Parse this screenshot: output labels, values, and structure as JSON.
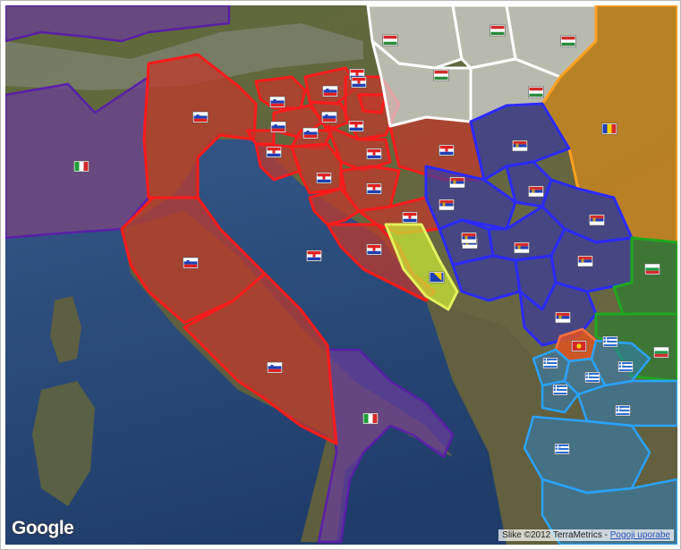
{
  "map": {
    "logo_text": "Google",
    "attribution_text": "Slike ©2012 TerraMetrics",
    "separator": " - ",
    "terms_link_text": "Pogoji uporabe"
  },
  "colors": {
    "sea": "#2b4d7c",
    "slovenia_region": "#c0392b",
    "slovenia_border": "#ff1a1a",
    "italy_region": "#6a3d9a",
    "hungary_region": "#d9d9d9",
    "romania_region": "#d4891c",
    "serbia_region": "#3a3a9c",
    "bulgaria_region": "#2e7d32",
    "greece_region": "#2d7fbd",
    "bosnia_region": "#c8e636",
    "macedonia_region": "#e0531f"
  },
  "region_flags": [
    {
      "region": "north-italy",
      "country": "italy"
    },
    {
      "region": "veneto",
      "country": "slovenia"
    },
    {
      "region": "tuscany",
      "country": "slovenia"
    },
    {
      "region": "lazio",
      "country": "slovenia"
    },
    {
      "region": "south-italy",
      "country": "italy"
    },
    {
      "region": "slovenia-1",
      "country": "slovenia"
    },
    {
      "region": "slovenia-2",
      "country": "slovenia"
    },
    {
      "region": "slovenia-3",
      "country": "slovenia"
    },
    {
      "region": "slovenia-4",
      "country": "slovenia"
    },
    {
      "region": "slovenia-5",
      "country": "slovenia"
    },
    {
      "region": "croatia-1",
      "country": "croatia"
    },
    {
      "region": "croatia-2",
      "country": "croatia"
    },
    {
      "region": "croatia-3",
      "country": "croatia"
    },
    {
      "region": "croatia-4",
      "country": "croatia"
    },
    {
      "region": "croatia-5",
      "country": "croatia"
    },
    {
      "region": "croatia-6",
      "country": "croatia"
    },
    {
      "region": "croatia-7",
      "country": "croatia"
    },
    {
      "region": "croatia-8",
      "country": "croatia"
    },
    {
      "region": "croatia-9",
      "country": "croatia"
    },
    {
      "region": "croatia-10",
      "country": "croatia"
    },
    {
      "region": "croatia-11",
      "country": "croatia"
    },
    {
      "region": "bosnia",
      "country": "bosnia"
    },
    {
      "region": "hungary-1",
      "country": "hungary"
    },
    {
      "region": "hungary-2",
      "country": "hungary"
    },
    {
      "region": "hungary-3",
      "country": "hungary"
    },
    {
      "region": "hungary-4",
      "country": "hungary"
    },
    {
      "region": "hungary-5",
      "country": "hungary"
    },
    {
      "region": "romania",
      "country": "romania"
    },
    {
      "region": "serbia-1",
      "country": "serbia"
    },
    {
      "region": "serbia-2",
      "country": "serbia"
    },
    {
      "region": "serbia-3",
      "country": "serbia"
    },
    {
      "region": "serbia-4",
      "country": "serbia"
    },
    {
      "region": "serbia-5",
      "country": "serbia"
    },
    {
      "region": "serbia-6",
      "country": "serbia"
    },
    {
      "region": "serbia-7",
      "country": "serbia"
    },
    {
      "region": "serbia-8",
      "country": "serbia"
    },
    {
      "region": "serbia-9",
      "country": "serbia"
    },
    {
      "region": "serbia-10",
      "country": "serbia"
    },
    {
      "region": "bulgaria-1",
      "country": "bulgaria"
    },
    {
      "region": "bulgaria-2",
      "country": "bulgaria"
    },
    {
      "region": "macedonia",
      "country": "macedonia"
    },
    {
      "region": "greece-1",
      "country": "greece"
    },
    {
      "region": "greece-2",
      "country": "greece"
    },
    {
      "region": "greece-3",
      "country": "greece"
    },
    {
      "region": "greece-4",
      "country": "greece"
    },
    {
      "region": "greece-5",
      "country": "greece"
    },
    {
      "region": "greece-6",
      "country": "greece"
    },
    {
      "region": "greece-7",
      "country": "greece"
    }
  ]
}
